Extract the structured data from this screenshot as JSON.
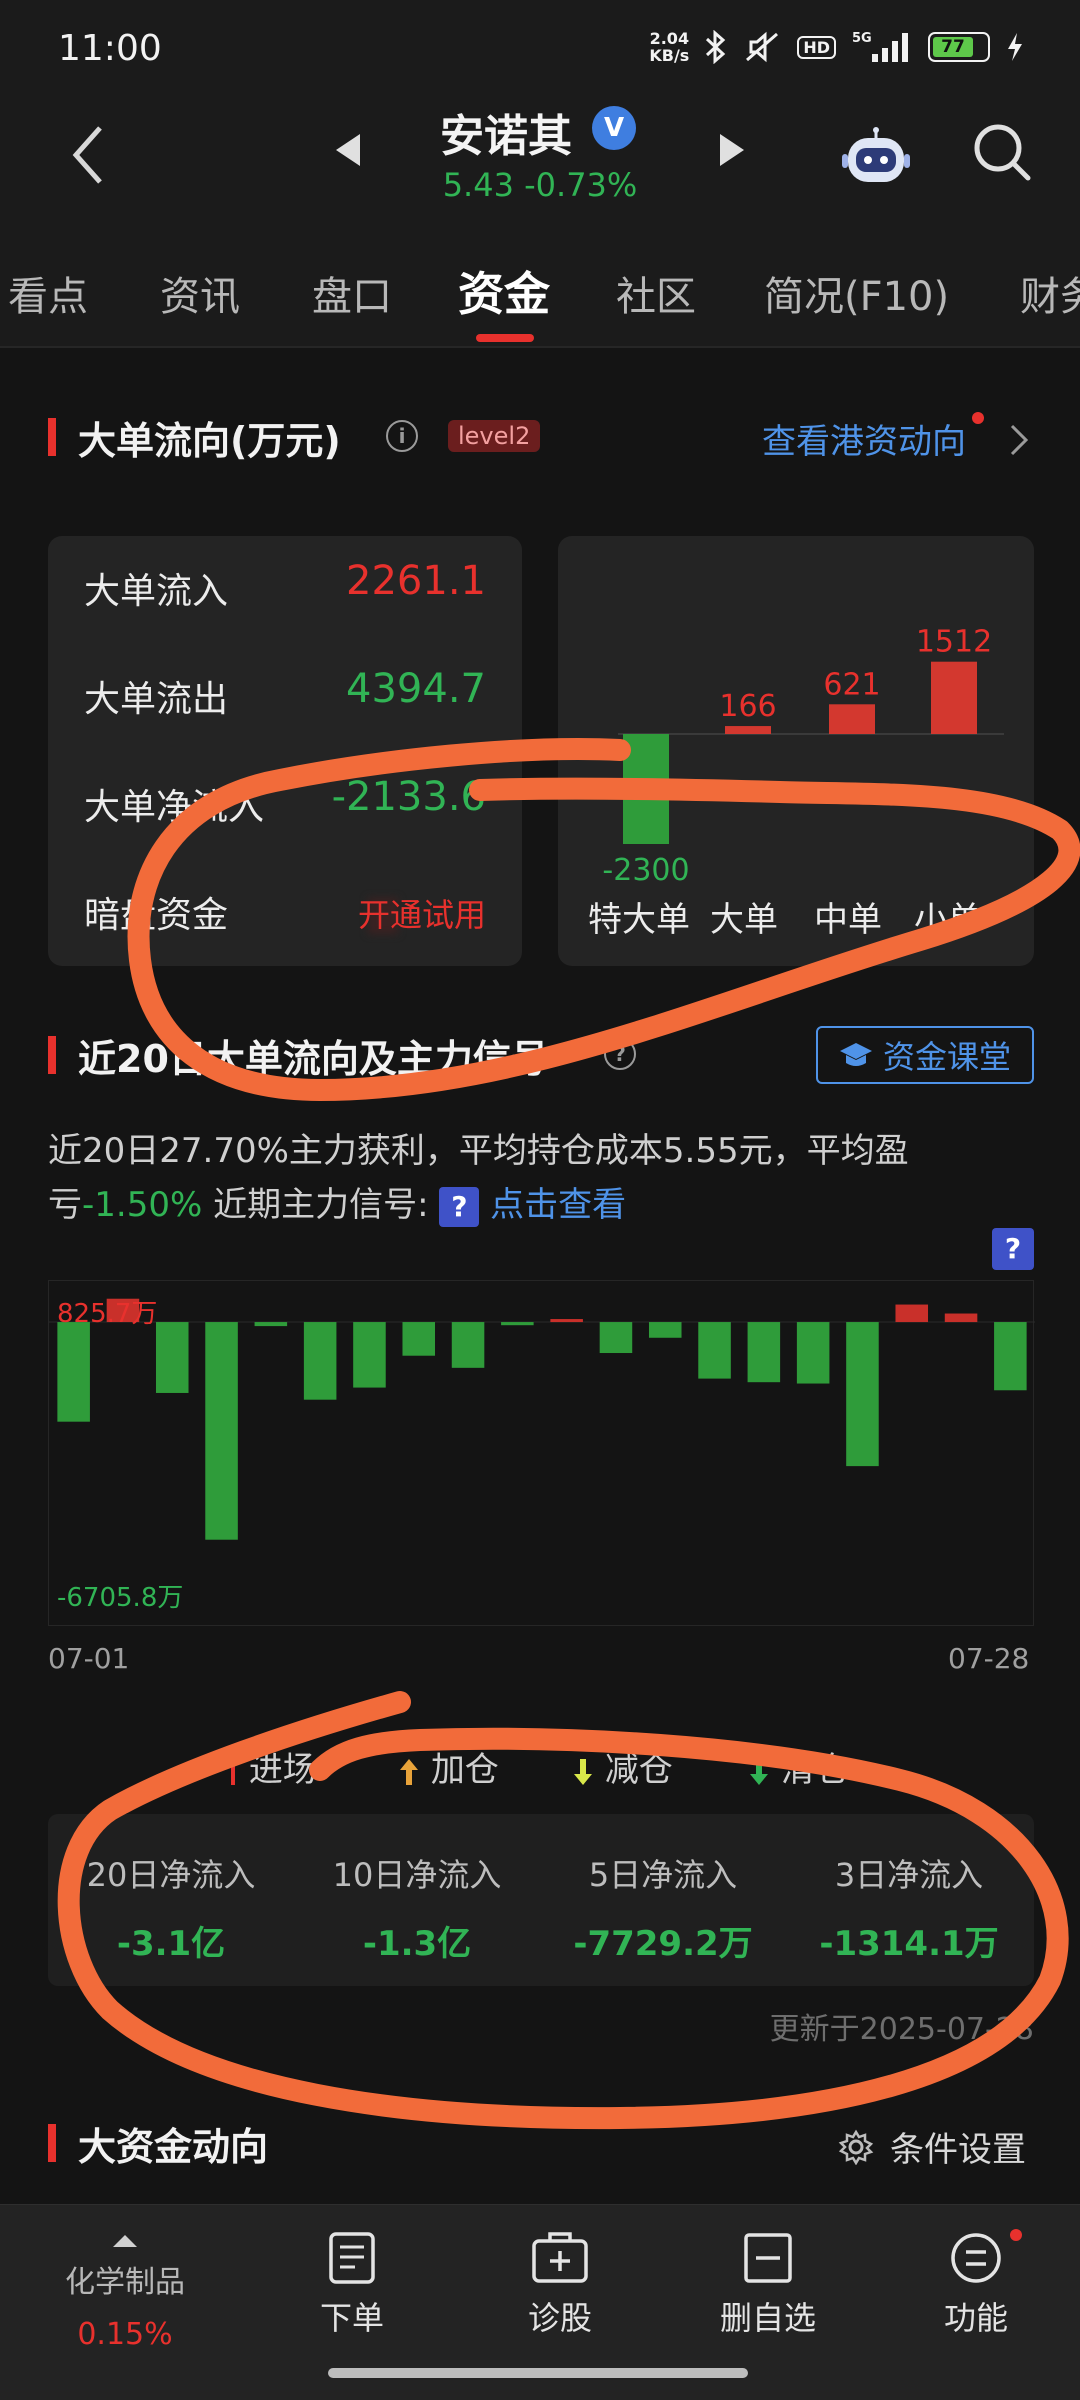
{
  "status_bar": {
    "time": "11:00",
    "speed_top": "2.04",
    "speed_bottom": "KB/s",
    "hd": "HD",
    "signal": "5G",
    "battery": "77"
  },
  "header": {
    "stock_name": "安诺其",
    "verified": "V",
    "price_line": "5.43 -0.73%"
  },
  "tabs": [
    "看点",
    "资讯",
    "盘口",
    "资金",
    "社区",
    "简况(F10)",
    "财务"
  ],
  "big_order_flow": {
    "title": "大单流向(万元)",
    "info": "i",
    "badge": "level2",
    "link": "查看港资动向",
    "rows": [
      {
        "label": "大单流入",
        "value": "2261.1"
      },
      {
        "label": "大单流出",
        "value": "4394.7"
      },
      {
        "label": "大单净流入",
        "value": "-2133.6"
      },
      {
        "label": "暗盘资金",
        "value": "开通试用"
      }
    ],
    "chart": {
      "categories": [
        "特大单",
        "大单",
        "中单",
        "小单"
      ],
      "values": [
        -2300,
        166,
        621,
        1512
      ],
      "value_labels": [
        "-2300",
        "166",
        "621",
        "1512"
      ]
    }
  },
  "signals": {
    "title": "近20日大单流向及主力信号",
    "info": "?",
    "class_button": "资金课堂",
    "summary_1": "近20日27.70%主力获利，平均持仓成本5.55元，平均盈亏",
    "summary_green": "-1.50%",
    "summary_2": " 近期主力信号:",
    "summary_q": "?",
    "summary_link": "点击查看",
    "help": "?",
    "max_label": "825.7万",
    "min_label": "-6705.8万",
    "date_start": "07-01",
    "date_end": "07-28",
    "legend": [
      "进场",
      "加仓",
      "减仓",
      "清仓"
    ],
    "net_inflows": [
      {
        "label": "20日净流入",
        "value": "-3.1亿"
      },
      {
        "label": "10日净流入",
        "value": "-1.3亿"
      },
      {
        "label": "5日净流入",
        "value": "-7729.2万"
      },
      {
        "label": "3日净流入",
        "value": "-1314.1万"
      }
    ],
    "updated": "更新于2025-07-28"
  },
  "chart_data": {
    "type": "bar",
    "title": "",
    "xlabel": "",
    "ylabel": "",
    "x_start": "07-01",
    "x_end": "07-28",
    "ylim": [
      -6705.8,
      825.7
    ],
    "unit": "万",
    "values": [
      -2220,
      520,
      -1580,
      -4850,
      -90,
      -1730,
      -1460,
      -750,
      -1020,
      -70,
      60,
      -690,
      -350,
      -1260,
      -1340,
      -1370,
      -3210,
      390,
      190,
      -1520
    ]
  },
  "big_funds": {
    "title": "大资金动向",
    "settings": "条件设置"
  },
  "bottom_nav": {
    "sector_name": "化学制品",
    "sector_change": "0.15%",
    "items": [
      "下单",
      "诊股",
      "删自选",
      "功能"
    ]
  },
  "colors": {
    "up": "#e8312d",
    "down": "#2f9c3a",
    "accent": "#4f93e8",
    "annotation": "#f26b3a"
  }
}
